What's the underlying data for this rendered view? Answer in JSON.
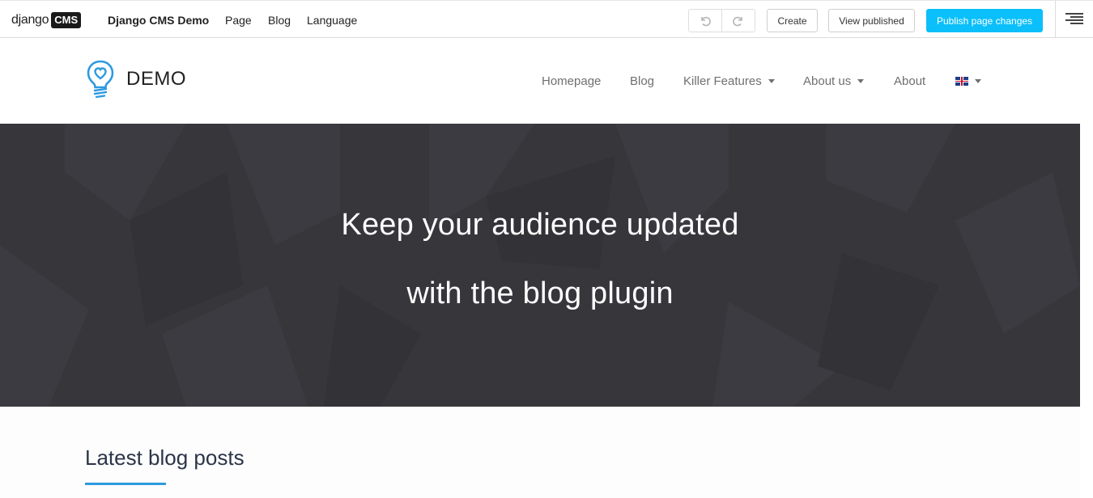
{
  "cms_toolbar": {
    "logo_word": "django",
    "logo_badge": "CMS",
    "site_name": "Django CMS Demo",
    "menu": {
      "page": "Page",
      "blog": "Blog",
      "language": "Language"
    },
    "undo_icon": "undo-icon",
    "redo_icon": "redo-icon",
    "create_label": "Create",
    "view_published_label": "View published",
    "publish_label": "Publish page changes",
    "structure_icon": "structure-mode-icon",
    "accent_color": "#0bbffa"
  },
  "site_header": {
    "brand": "DEMO",
    "brand_icon": "lightbulb-heart-icon",
    "nav": {
      "homepage": "Homepage",
      "blog": "Blog",
      "killer_features": "Killer Features",
      "about_us": "About us",
      "about": "About"
    },
    "language_flag": "uk-flag-icon"
  },
  "hero": {
    "line1": "Keep your audience updated",
    "line2": "with the blog plugin",
    "background_color": "#36363b"
  },
  "latest": {
    "title": "Latest blog posts",
    "underline_color": "#2d9ae0"
  }
}
